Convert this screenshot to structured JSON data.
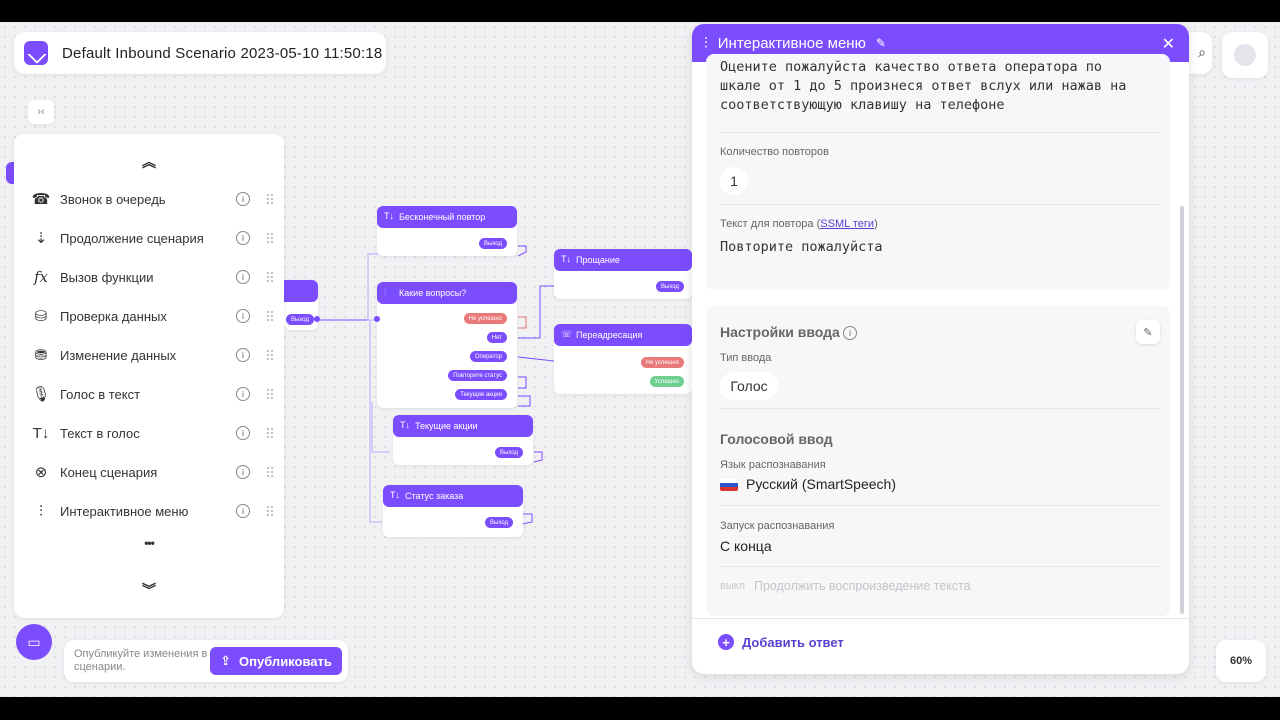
{
  "app": {
    "title": "Default Inbound Scenario 2023-05-10 11:50:18",
    "collapse_label": "›‹"
  },
  "sidebar": {
    "items": [
      {
        "label": "Звонок в очередь",
        "icon": "queue-call-icon"
      },
      {
        "label": "Продолжение сценария",
        "icon": "continue-scenario-icon"
      },
      {
        "label": "Вызов функции",
        "icon": "function-icon"
      },
      {
        "label": "Проверка данных",
        "icon": "data-check-icon"
      },
      {
        "label": "Изменение данных",
        "icon": "data-edit-icon"
      },
      {
        "label": "Голос в текст",
        "icon": "speech-to-text-icon"
      },
      {
        "label": "Текст в голос",
        "icon": "text-to-speech-icon"
      },
      {
        "label": "Конец сценария",
        "icon": "end-scenario-icon"
      },
      {
        "label": "Интерактивное меню",
        "icon": "interactive-menu-icon"
      }
    ],
    "more": "•••"
  },
  "canvas": {
    "nodes": {
      "infinite": {
        "title": "Бесконечный повтор",
        "out": "Выход"
      },
      "questions": {
        "title": "Какие вопросы?",
        "outs": [
          "Не успешно",
          "Нет",
          "Оператор",
          "Повторите статус",
          "Текущие акции"
        ]
      },
      "farewell": {
        "title": "Прощание",
        "out": "Выход"
      },
      "redirect": {
        "title": "Переадресация",
        "outs": [
          "Не успешно",
          "Успешно"
        ]
      },
      "promos": {
        "title": "Текущие акции",
        "out": "Выход"
      },
      "order": {
        "title": "Статус заказа",
        "out": "Выход"
      },
      "left_out": "Выход"
    }
  },
  "publish": {
    "hint": "Опубликуйте изменения в сценарии.",
    "button": "Опубликовать"
  },
  "zoom": "60%",
  "panel": {
    "title": "Интерактивное меню",
    "prompt_text": "Оцените пожалуйста качество ответа оператора по шкале от 1 до 5 произнеся ответ вслух или нажав на соответствующую клавишу на телефоне",
    "repeat_count_label": "Количество повторов",
    "repeat_count_value": "1",
    "repeat_text_label": "Текст для повтора (",
    "repeat_text_link": "SSML теги",
    "repeat_text_label_end": ")",
    "repeat_text_value": "Повторите пожалуйста",
    "input_settings_title": "Настройки ввода",
    "input_type_label": "Тип ввода",
    "input_type_value": "Голос",
    "voice_input_title": "Голосовой ввод",
    "lang_label": "Язык распознавания",
    "lang_value": "Русский (SmartSpeech)",
    "start_label": "Запуск распознавания",
    "start_value": "С конца",
    "toggle_state": "выкл",
    "toggle_label": "Продолжить воспроизведение текста",
    "add_answer": "Добавить ответ"
  }
}
